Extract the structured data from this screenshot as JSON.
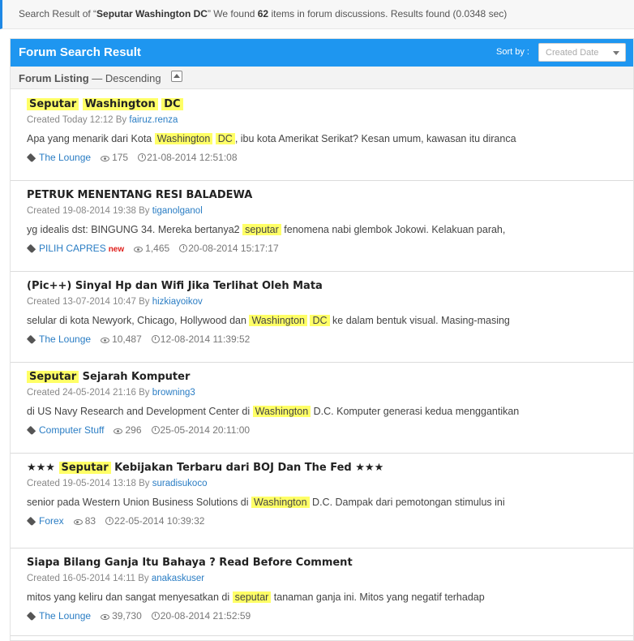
{
  "summary": {
    "prefix": "Search Result of “",
    "query": "Seputar Washington DC",
    "middle": "” We found ",
    "count": "62",
    "suffix": " items in forum discussions. Results found (0.0348 sec)"
  },
  "panel": {
    "title": "Forum Search Result",
    "sort_label": "Sort by :",
    "sort_placeholder": "Created Date"
  },
  "listing": {
    "label": "Forum Listing",
    "dash": " — ",
    "order": "Descending"
  },
  "colors": {
    "accent": "#1e96f0",
    "highlight": "#ffff66",
    "link": "#2a7dc4",
    "new_badge": "#e0201c"
  },
  "results": [
    {
      "title_parts": [
        {
          "t": "Seputar",
          "h": true
        },
        {
          "t": " ",
          "h": false
        },
        {
          "t": "Washington",
          "h": true
        },
        {
          "t": " ",
          "h": false
        },
        {
          "t": "DC",
          "h": true
        }
      ],
      "created": "Created Today 12:12 By ",
      "author": "fairuz.renza",
      "snippet_parts": [
        {
          "t": "Apa yang menarik dari Kota ",
          "h": false
        },
        {
          "t": "Washington",
          "h": true
        },
        {
          "t": " ",
          "h": false
        },
        {
          "t": "DC",
          "h": true
        },
        {
          "t": ", ibu kota Amerikat Serikat? Kesan umum, kawasan itu diranca",
          "h": false
        }
      ],
      "forum": "The Lounge",
      "new": "",
      "views": "175",
      "last": "21-08-2014 12:51:08"
    },
    {
      "title_parts": [
        {
          "t": "PETRUK MENENTANG RESI BALADEWA",
          "h": false
        }
      ],
      "created": "Created 19-08-2014 19:38 By ",
      "author": "tiganolganol",
      "snippet_parts": [
        {
          "t": "yg idealis dst: BINGUNG 34. Mereka bertanya2 ",
          "h": false
        },
        {
          "t": "seputar",
          "h": true
        },
        {
          "t": " fenomena nabi glembok Jokowi. Kelakuan parah,",
          "h": false
        }
      ],
      "forum": "PILIH CAPRES",
      "new": "new",
      "views": "1,465",
      "last": "20-08-2014 15:17:17"
    },
    {
      "title_parts": [
        {
          "t": "(Pic++) Sinyal Hp dan Wifi Jika Terlihat Oleh Mata",
          "h": false
        }
      ],
      "created": "Created 13-07-2014 10:47 By ",
      "author": "hizkiayoikov",
      "snippet_parts": [
        {
          "t": "selular di kota Newyork, Chicago, Hollywood dan ",
          "h": false
        },
        {
          "t": "Washington",
          "h": true
        },
        {
          "t": " ",
          "h": false
        },
        {
          "t": "DC",
          "h": true
        },
        {
          "t": " ke dalam bentuk visual. Masing-masing",
          "h": false
        }
      ],
      "forum": "The Lounge",
      "new": "",
      "views": "10,487",
      "last": "12-08-2014 11:39:52"
    },
    {
      "title_parts": [
        {
          "t": "Seputar",
          "h": true
        },
        {
          "t": " Sejarah Komputer",
          "h": false
        }
      ],
      "created": "Created 24-05-2014 21:16 By ",
      "author": "browning3",
      "snippet_parts": [
        {
          "t": "di US Navy Research and Development Center di ",
          "h": false
        },
        {
          "t": "Washington",
          "h": true
        },
        {
          "t": " D.C. Komputer generasi kedua menggantikan",
          "h": false
        }
      ],
      "forum": "Computer Stuff",
      "new": "",
      "views": "296",
      "last": "25-05-2014 20:11:00"
    },
    {
      "title_parts": [
        {
          "t": "★★★ ",
          "h": false
        },
        {
          "t": "Seputar",
          "h": true
        },
        {
          "t": " Kebijakan Terbaru dari BOJ Dan The Fed ★★★",
          "h": false
        }
      ],
      "created": "Created 19-05-2014 13:18 By ",
      "author": "suradisukoco",
      "snippet_parts": [
        {
          "t": "senior pada Western Union Business Solutions di ",
          "h": false
        },
        {
          "t": "Washington",
          "h": true
        },
        {
          "t": " D.C. Dampak dari pemotongan stimulus ini",
          "h": false
        }
      ],
      "forum": "Forex",
      "new": "",
      "views": "83",
      "last": "22-05-2014 10:39:32"
    },
    {
      "title_parts": [
        {
          "t": "Siapa Bilang Ganja Itu Bahaya ? Read Before Comment",
          "h": false
        }
      ],
      "created": "Created 16-05-2014 14:11 By ",
      "author": "anakaskuser",
      "snippet_parts": [
        {
          "t": "mitos yang keliru dan sangat menyesatkan di ",
          "h": false
        },
        {
          "t": "seputar",
          "h": true
        },
        {
          "t": " tanaman ganja ini. Mitos yang negatif terhadap",
          "h": false
        }
      ],
      "forum": "The Lounge",
      "new": "",
      "views": "39,730",
      "last": "20-08-2014 21:52:59"
    }
  ]
}
